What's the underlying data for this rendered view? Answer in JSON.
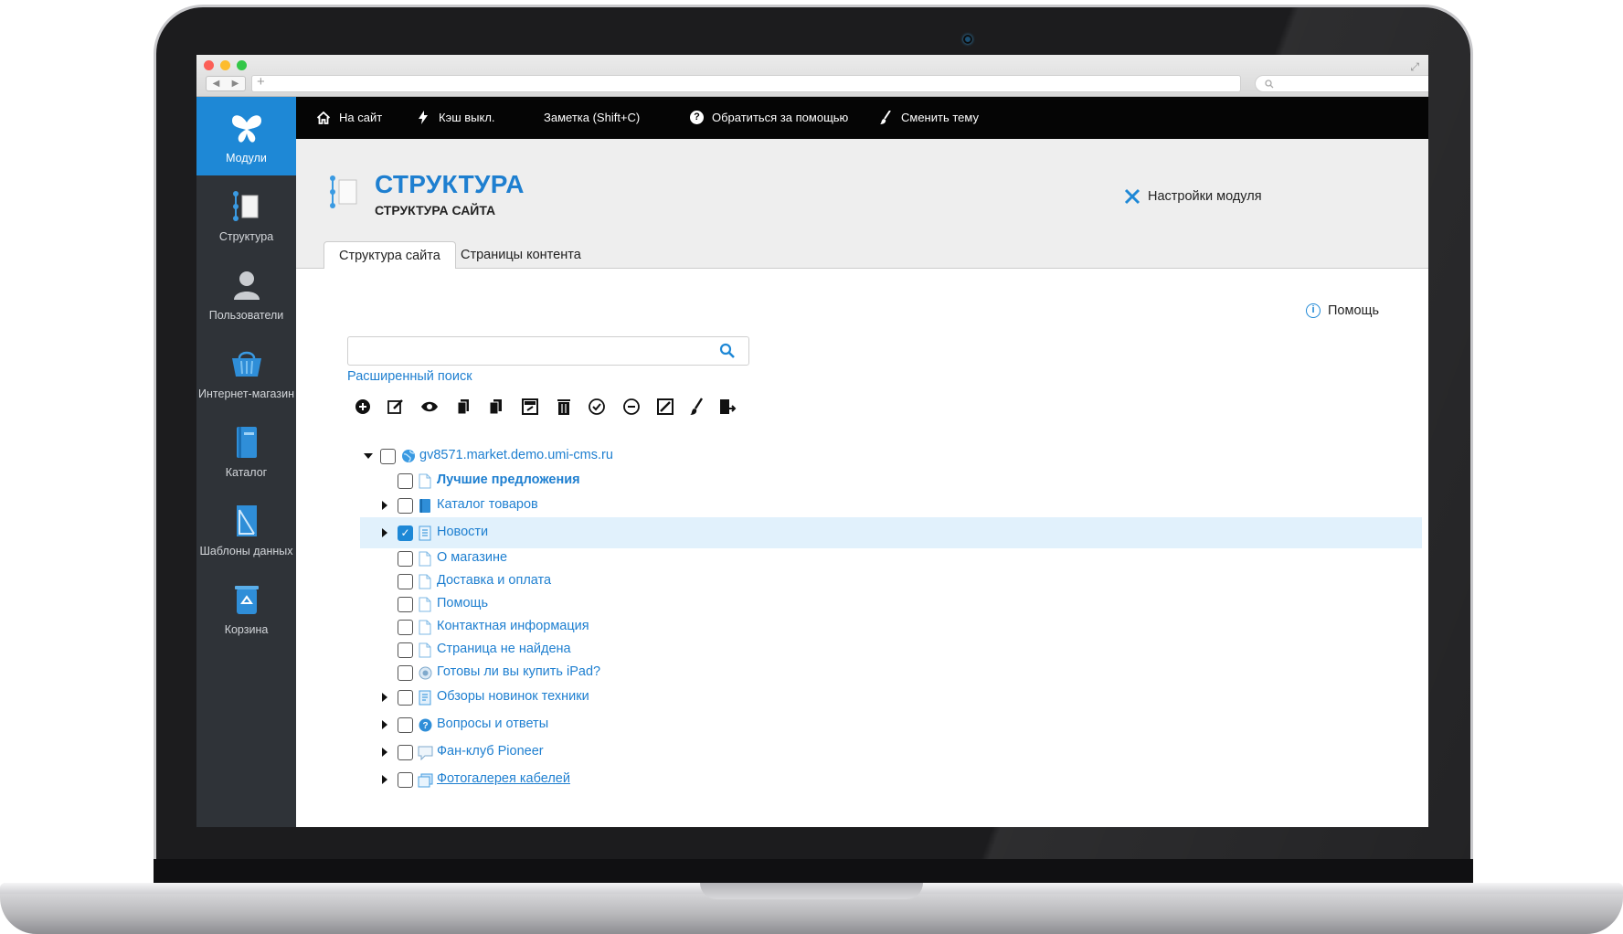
{
  "browser": {
    "nav_back": "◀",
    "nav_forward": "▶",
    "new_tab": "+",
    "search_placeholder": "",
    "fullscreen_icon": "resize-icon"
  },
  "sidebar": {
    "items": [
      {
        "label": "Модули",
        "icon": "butterfly-icon",
        "active": true
      },
      {
        "label": "Структура",
        "icon": "structure-icon",
        "active": false
      },
      {
        "label": "Пользователи",
        "icon": "user-icon",
        "active": false
      },
      {
        "label": "Интернет-магазин",
        "icon": "basket-icon",
        "active": false
      },
      {
        "label": "Каталог",
        "icon": "catalog-book-icon",
        "active": false
      },
      {
        "label": "Шаблоны данных",
        "icon": "data-template-icon",
        "active": false
      },
      {
        "label": "Корзина",
        "icon": "recycle-bin-icon",
        "active": false
      }
    ]
  },
  "topbar": {
    "items": [
      {
        "label": "На сайт",
        "icon": "home-icon"
      },
      {
        "label": "Кэш выкл.",
        "icon": "lightning-icon"
      },
      {
        "label": "Заметка (Shift+C)",
        "icon": ""
      },
      {
        "label": "Обратиться за помощью",
        "icon": "question-icon"
      },
      {
        "label": "Сменить тему",
        "icon": "brush-icon"
      }
    ]
  },
  "header": {
    "title": "СТРУКТУРА",
    "subtitle": "СТРУКТУРА САЙТА",
    "module_settings": "Настройки модуля",
    "tabs": [
      {
        "label": "Структура сайта",
        "active": true
      },
      {
        "label": "Страницы контента",
        "active": false
      }
    ]
  },
  "content": {
    "help": "Помощь",
    "search_value": "",
    "search_placeholder": "",
    "advanced_search": "Расширенный поиск",
    "toolbar_icons": [
      "add-icon",
      "edit-icon",
      "view-icon",
      "copy-icon",
      "copy-virtual-icon",
      "move-icon",
      "delete-icon",
      "activate-icon",
      "deactivate-icon",
      "change-template-icon",
      "edit-style-icon",
      "export-icon"
    ]
  },
  "tree": {
    "root": {
      "label": "gv8571.market.demo.umi-cms.ru",
      "icon": "globe-icon",
      "expanded": true,
      "checked": false
    },
    "children": [
      {
        "label": "Лучшие предложения",
        "icon": "page-icon",
        "expandable": false,
        "checked": false,
        "bold": true
      },
      {
        "label": "Каталог товаров",
        "icon": "catalog-book-icon",
        "expandable": true,
        "checked": false,
        "bold": false
      },
      {
        "label": "Новости",
        "icon": "news-icon",
        "expandable": true,
        "checked": true,
        "bold": false,
        "selected": true
      },
      {
        "label": "О магазине",
        "icon": "page-icon",
        "expandable": false,
        "checked": false,
        "bold": false
      },
      {
        "label": "Доставка и оплата",
        "icon": "page-icon",
        "expandable": false,
        "checked": false,
        "bold": false
      },
      {
        "label": "Помощь",
        "icon": "page-icon",
        "expandable": false,
        "checked": false,
        "bold": false
      },
      {
        "label": "Контактная информация",
        "icon": "page-icon",
        "expandable": false,
        "checked": false,
        "bold": false
      },
      {
        "label": "Страница не найдена",
        "icon": "page-icon",
        "expandable": false,
        "checked": false,
        "bold": false
      },
      {
        "label": "Готовы ли вы купить iPad?",
        "icon": "poll-icon",
        "expandable": false,
        "checked": false,
        "bold": false
      },
      {
        "label": "Обзоры новинок техники",
        "icon": "blog-icon",
        "expandable": true,
        "checked": false,
        "bold": false
      },
      {
        "label": "Вопросы и ответы",
        "icon": "faq-icon",
        "expandable": true,
        "checked": false,
        "bold": false
      },
      {
        "label": "Фан-клуб Pioneer",
        "icon": "forum-icon",
        "expandable": true,
        "checked": false,
        "bold": false
      },
      {
        "label": "Фотогалерея кабелей",
        "icon": "photo-album-icon",
        "expandable": true,
        "checked": false,
        "bold": false
      }
    ]
  },
  "colors": {
    "accent": "#1e88d6",
    "link": "#1e7fd0",
    "sidebar_bg": "#2f3338",
    "topbar_bg": "#050505",
    "selected_row": "#e1f1fc"
  }
}
